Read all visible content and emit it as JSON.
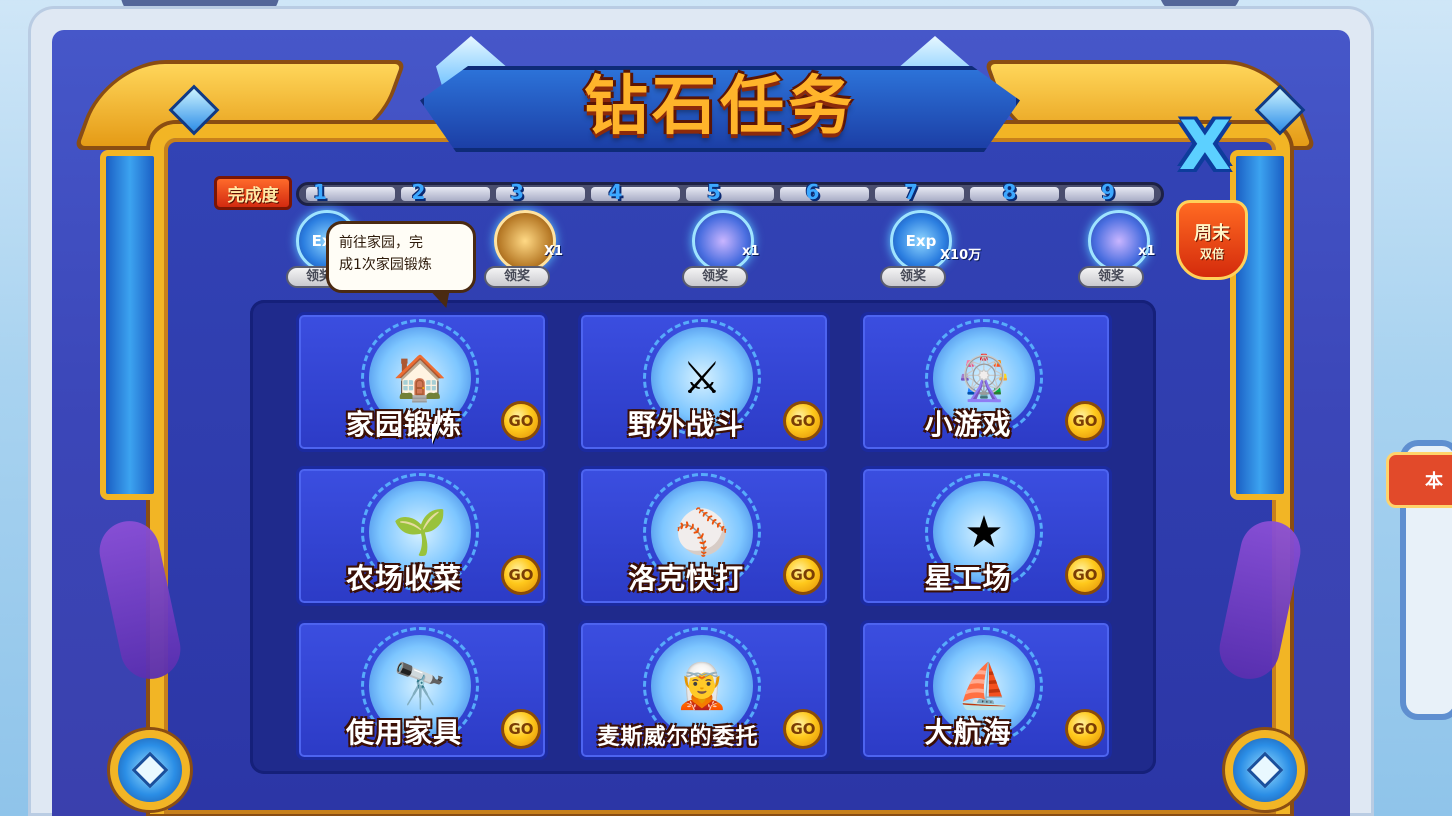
{
  "dialog": {
    "title": "钻石任务",
    "close_icon": "close-x-icon"
  },
  "progress": {
    "label": "完成度",
    "nodes": [
      "1",
      "2",
      "3",
      "4",
      "5",
      "6",
      "7",
      "8",
      "9"
    ],
    "completed": 0
  },
  "rewards": [
    {
      "node": "1",
      "icon": "exp-icon",
      "text": "Exp",
      "quantity": "",
      "claim_label": "领奖"
    },
    {
      "node": "3",
      "icon": "book-icon",
      "text": "",
      "quantity": "X1",
      "claim_label": "领奖"
    },
    {
      "node": "5",
      "icon": "card-icon",
      "text": "",
      "quantity": "x1",
      "claim_label": "领奖"
    },
    {
      "node": "7",
      "icon": "exp-icon",
      "text": "Exp",
      "quantity": "X10万",
      "claim_label": "领奖"
    },
    {
      "node": "9",
      "icon": "card-icon",
      "text": "",
      "quantity": "x1",
      "claim_label": "领奖"
    }
  ],
  "weekend_badge": {
    "line1": "周末",
    "line2": "双倍"
  },
  "tooltip": {
    "line1": "前往家园，完",
    "line2": "成1次家园锻炼"
  },
  "tasks": [
    {
      "name": "家园锻炼",
      "icon": "house-icon",
      "go": "GO"
    },
    {
      "name": "野外战斗",
      "icon": "vs-battle-icon",
      "go": "GO"
    },
    {
      "name": "小游戏",
      "icon": "ferris-wheel-icon",
      "go": "GO"
    },
    {
      "name": "农场收菜",
      "icon": "sprout-icon",
      "go": "GO"
    },
    {
      "name": "洛克快打",
      "icon": "baseball-player-icon",
      "go": "GO"
    },
    {
      "name": "星工场",
      "icon": "star-r-icon",
      "go": "GO"
    },
    {
      "name": "使用家具",
      "icon": "telescope-robot-icon",
      "go": "GO"
    },
    {
      "name": "麦斯威尔的委托",
      "icon": "elf-character-icon",
      "go": "GO"
    },
    {
      "name": "大航海",
      "icon": "ship-icon",
      "go": "GO"
    }
  ],
  "colors": {
    "panel_blue": "#2c3bc6",
    "gold_frame": "#f2b525",
    "title_orange": "#ffb42b",
    "go_yellow": "#ffc91c"
  }
}
